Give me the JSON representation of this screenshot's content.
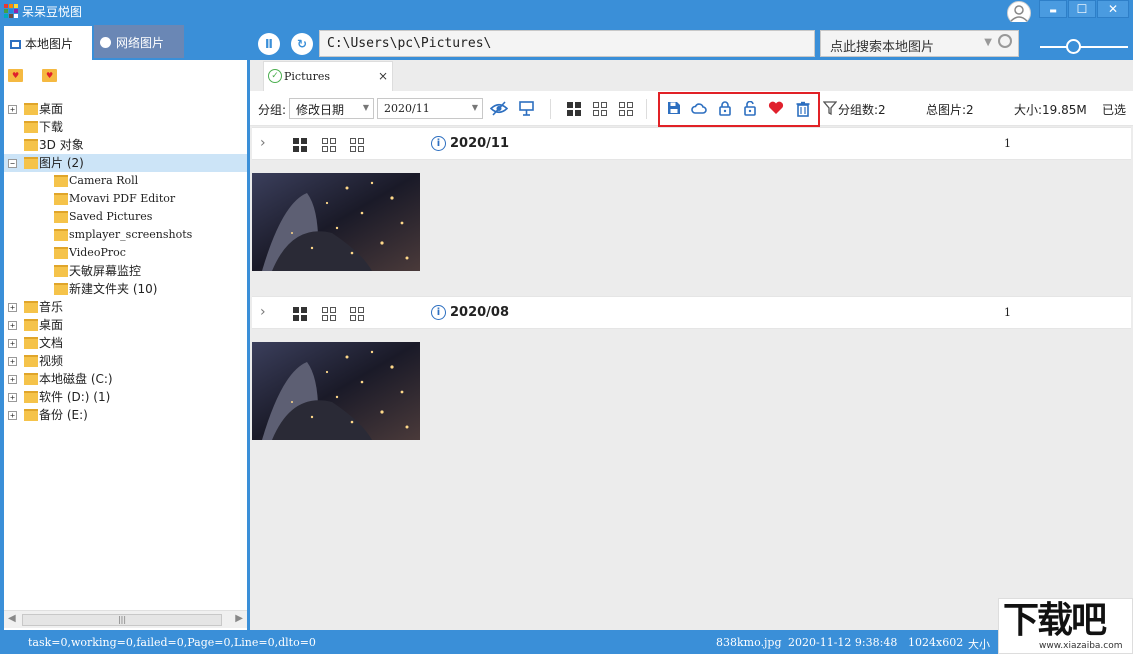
{
  "app": {
    "title": "呆呆豆悦图"
  },
  "window": {
    "minimize": "▬",
    "maximize": "☐",
    "close": "✕"
  },
  "tabs": {
    "local": "本地图片",
    "network": "网络图片"
  },
  "path": {
    "value": "C:\\Users\\pc\\Pictures\\"
  },
  "search": {
    "placeholder": "点此搜索本地图片"
  },
  "buttons": {
    "pause": "Ⅱ",
    "refresh": "↻"
  },
  "tree": [
    {
      "label": "桌面",
      "expander": "+",
      "level": 0
    },
    {
      "label": "下载",
      "expander": "",
      "level": 0
    },
    {
      "label": "3D 对象",
      "expander": "",
      "level": 0
    },
    {
      "label": "图片 (2)",
      "expander": "−",
      "level": 0,
      "selected": true
    },
    {
      "label": "Camera Roll",
      "expander": "",
      "level": 1
    },
    {
      "label": "Movavi PDF Editor",
      "expander": "",
      "level": 1
    },
    {
      "label": "Saved Pictures",
      "expander": "",
      "level": 1
    },
    {
      "label": "smplayer_screenshots",
      "expander": "",
      "level": 1
    },
    {
      "label": "VideoProc",
      "expander": "",
      "level": 1
    },
    {
      "label": "天敏屏幕监控",
      "expander": "",
      "level": 1
    },
    {
      "label": "新建文件夹 (10)",
      "expander": "",
      "level": 1
    },
    {
      "label": "音乐",
      "expander": "+",
      "level": 0
    },
    {
      "label": "桌面",
      "expander": "+",
      "level": 0
    },
    {
      "label": "文档",
      "expander": "+",
      "level": 0
    },
    {
      "label": "视频",
      "expander": "+",
      "level": 0
    },
    {
      "label": "本地磁盘 (C:)",
      "expander": "+",
      "level": 0
    },
    {
      "label": "软件 (D:) (1)",
      "expander": "+",
      "level": 0
    },
    {
      "label": "备份 (E:)",
      "expander": "+",
      "level": 0
    }
  ],
  "doc_tab": {
    "label": "Pictures",
    "close": "×"
  },
  "toolbar": {
    "group_label": "分组:",
    "group_value": "修改日期",
    "date_value": "2020/11",
    "group_count": "分组数:2",
    "total": "总图片:2",
    "size": "大小:19.85M",
    "selected": "已选"
  },
  "groups": [
    {
      "date": "2020/11",
      "count": "1"
    },
    {
      "date": "2020/08",
      "count": "1"
    }
  ],
  "status": {
    "left": "task=0,working=0,failed=0,Page=0,Line=0,dlto=0",
    "file": "838kmo.jpg",
    "datetime": "2020-11-12 9:38:48",
    "dims": "1024x602",
    "size_label": "大小"
  },
  "watermark": {
    "big": "下载吧",
    "small": "www.xiazaiba.com"
  },
  "colors": {
    "accent": "#3a8fd8",
    "highlight": "#e12126",
    "icon_blue": "#2d6fc0",
    "heart": "#e0202c"
  }
}
